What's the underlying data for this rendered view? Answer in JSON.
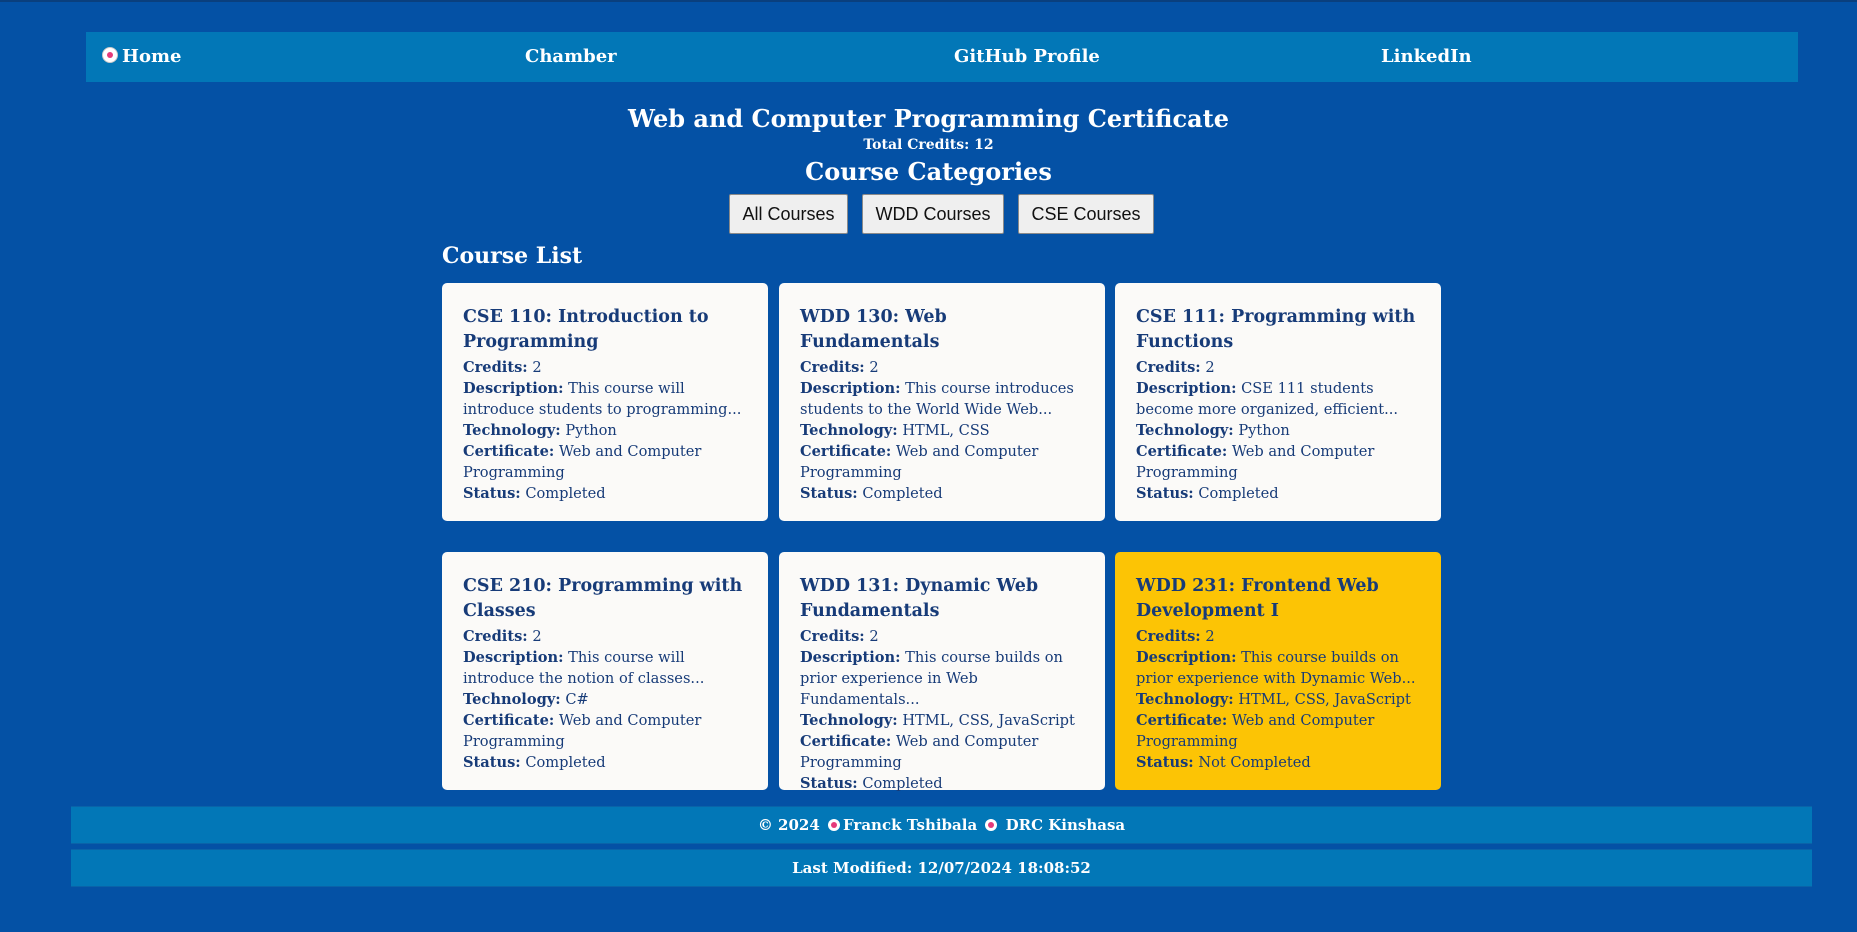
{
  "nav": {
    "home": "Home",
    "chamber": "Chamber",
    "github": "GitHub Profile",
    "linkedin": "LinkedIn"
  },
  "header": {
    "title": "Web and Computer Programming Certificate",
    "total_credits": "Total Credits: 12",
    "categories_title": "Course Categories"
  },
  "filters": {
    "all": "All Courses",
    "wdd": "WDD Courses",
    "cse": "CSE Courses"
  },
  "course_list_title": "Course List",
  "labels": {
    "credits": "Credits:",
    "description": "Description:",
    "technology": "Technology:",
    "certificate": "Certificate:",
    "status": "Status:"
  },
  "courses": [
    {
      "title": "CSE 110: Introduction to Programming",
      "credits": "2",
      "description": "This course will introduce students to programming...",
      "technology": "Python",
      "certificate": "Web and Computer Programming",
      "status": "Completed"
    },
    {
      "title": "WDD 130: Web Fundamentals",
      "credits": "2",
      "description": "This course introduces students to the World Wide Web...",
      "technology": "HTML, CSS",
      "certificate": "Web and Computer Programming",
      "status": "Completed"
    },
    {
      "title": "CSE 111: Programming with Functions",
      "credits": "2",
      "description": "CSE 111 students become more organized, efficient...",
      "technology": "Python",
      "certificate": "Web and Computer Programming",
      "status": "Completed"
    },
    {
      "title": "CSE 210: Programming with Classes",
      "credits": "2",
      "description": "This course will introduce the notion of classes...",
      "technology": "C#",
      "certificate": "Web and Computer Programming",
      "status": "Completed"
    },
    {
      "title": "WDD 131: Dynamic Web Fundamentals",
      "credits": "2",
      "description": "This course builds on prior experience in Web Fundamentals...",
      "technology": "HTML, CSS, JavaScript",
      "certificate": "Web and Computer Programming",
      "status": "Completed"
    },
    {
      "title": "WDD 231: Frontend Web Development I",
      "credits": "2",
      "description": "This course builds on prior experience with Dynamic Web...",
      "technology": "HTML, CSS, JavaScript",
      "certificate": "Web and Computer Programming",
      "status": "Not Completed"
    }
  ],
  "footer": {
    "copyright_prefix": "© 2024",
    "author": "Franck Tshibala",
    "location": "DRC Kinshasa",
    "last_modified": "Last Modified: 12/07/2024 18:08:52"
  },
  "colors": {
    "background": "#0451a5",
    "nav_bar": "#0277b7",
    "card": "#fbfaf8",
    "card_not_completed": "#fcc405",
    "card_text": "#173b78"
  },
  "icons": {
    "home": "soccer-ball-icon",
    "footer": "soccer-ball-icon"
  }
}
